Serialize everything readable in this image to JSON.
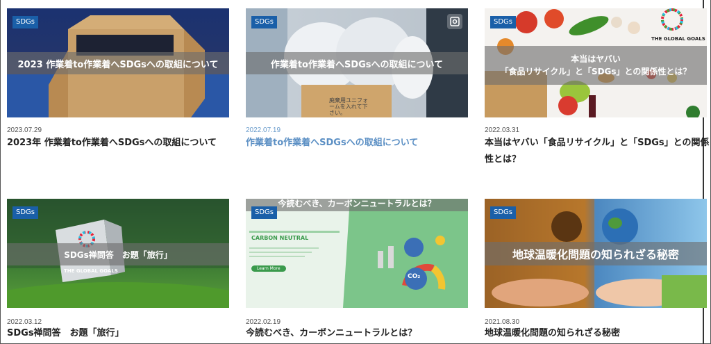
{
  "cards": [
    {
      "badge": "SDGs",
      "overlay": "2023 作業着to作業着へSDGsへの取組について",
      "date": "2023.07.29",
      "title": "2023年 作業着to作業着へSDGsへの取組について"
    },
    {
      "badge": "SDGs",
      "overlay": "作業着to作業着へSDGsへの取組について",
      "date": "2022.07.19",
      "title": "作業着to作業着へSDGsへの取組について",
      "box_text": "廃棄用ユニフォームを入れて下さい。"
    },
    {
      "badge": "SDGs",
      "overlay_line1": "本当はヤバい",
      "overlay_line2": "「食品リサイクル」と「SDGs」との関係性とは？",
      "date": "2022.03.31",
      "title_line1": "本当はヤバい「食品リサイクル」と「SDGs」との関係",
      "title_line2": "性とは？",
      "logo_text": "THE GLOBAL GOALS"
    },
    {
      "badge": "SDGs",
      "overlay": "SDGs禅問答　お題「旅行」",
      "date": "2022.03.12",
      "title": "SDGs禅問答　お題「旅行」",
      "logo_text": "THE GLOBAL GOALS"
    },
    {
      "badge": "SDGs",
      "overlay": "今読むべき、カーボンニュートラルとは？",
      "date": "2022.02.19",
      "title": "今読むべき、カーボンニュートラルとは？",
      "panel_title": "CARBON NEUTRAL",
      "panel_button": "Learn More",
      "co2": "CO₂"
    },
    {
      "badge": "SDGs",
      "overlay": "地球温暖化問題の知られざる秘密",
      "date": "2021.08.30",
      "title": "地球温暖化問題の知られざる秘密"
    }
  ]
}
